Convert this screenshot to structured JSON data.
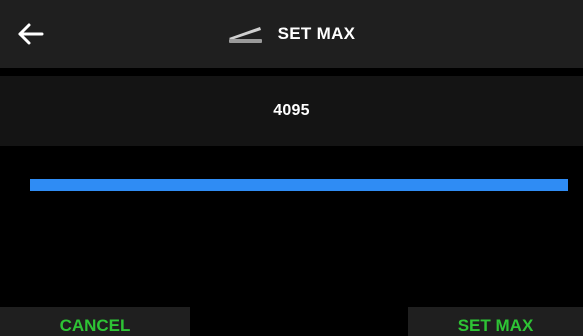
{
  "header": {
    "back_icon": "arrow-left-icon",
    "pedal_icon": "expression-pedal-icon",
    "title": "SET MAX"
  },
  "value": {
    "display": "4095"
  },
  "level": {
    "fraction": 1.0,
    "color": "#2f8cf4"
  },
  "footer": {
    "cancel_label": "CANCEL",
    "set_max_label": "SET MAX",
    "accent_color": "#2ec435"
  },
  "colors": {
    "background": "#000000",
    "bar": "#1f1f1f",
    "panel": "#141414",
    "text": "#ffffff"
  }
}
